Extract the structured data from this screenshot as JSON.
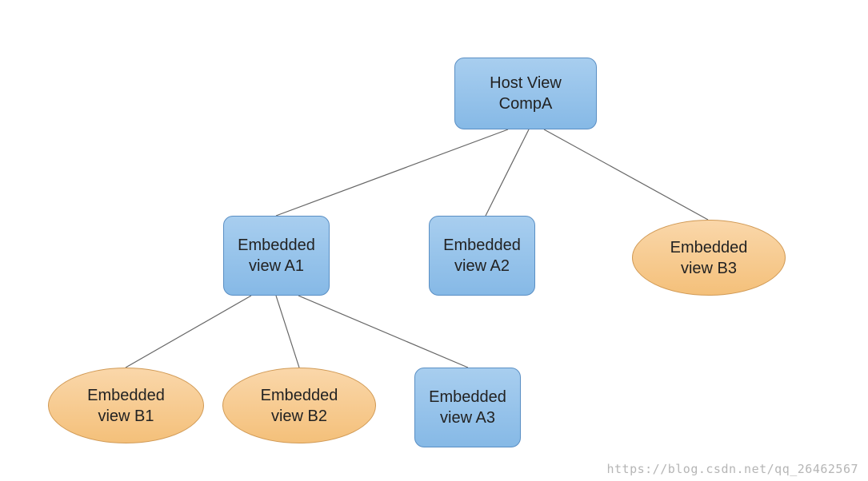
{
  "nodes": {
    "root": {
      "line1": "Host View",
      "line2": "CompA"
    },
    "a1": {
      "line1": "Embedded",
      "line2": "view A1"
    },
    "a2": {
      "line1": "Embedded",
      "line2": "view A2"
    },
    "b3": {
      "line1": "Embedded",
      "line2": "view B3"
    },
    "b1": {
      "line1": "Embedded",
      "line2": "view B1"
    },
    "b2": {
      "line1": "Embedded",
      "line2": "view B2"
    },
    "a3": {
      "line1": "Embedded",
      "line2": "view A3"
    }
  },
  "watermark": "https://blog.csdn.net/qq_26462567"
}
